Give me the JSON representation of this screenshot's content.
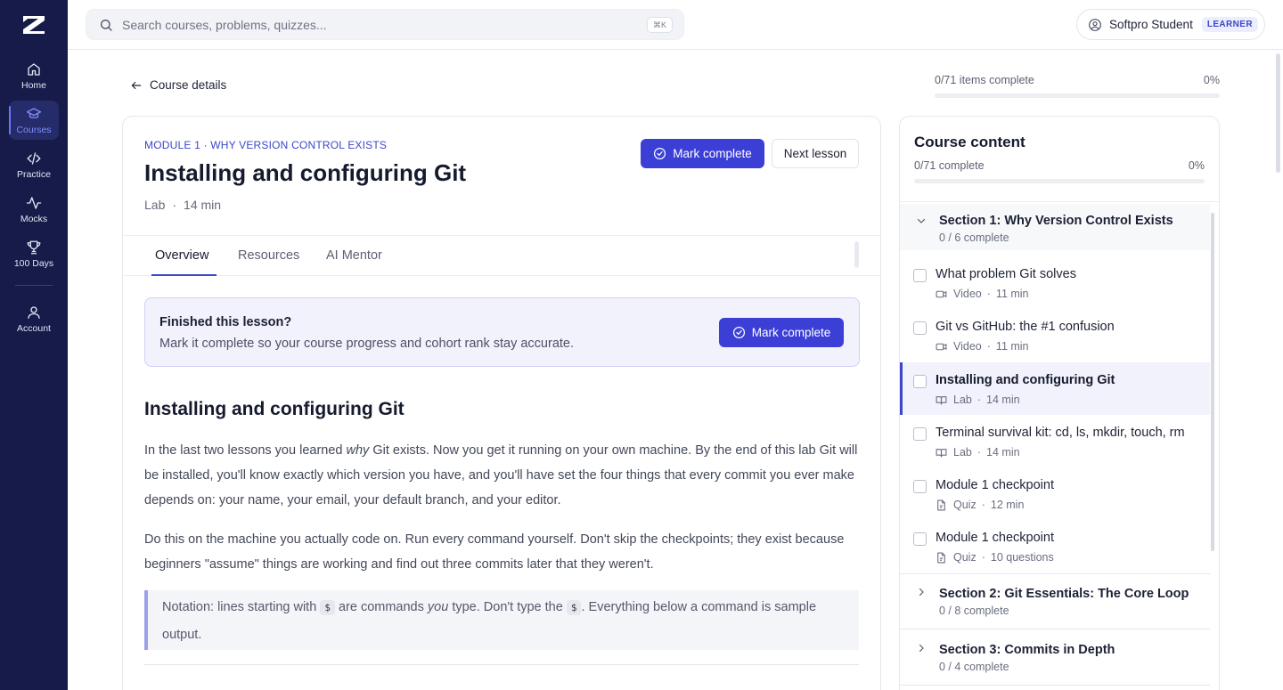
{
  "nav": {
    "items": [
      {
        "label": "Home",
        "icon": "home-icon"
      },
      {
        "label": "Courses",
        "icon": "courses-icon",
        "active": true
      },
      {
        "label": "Practice",
        "icon": "code-icon"
      },
      {
        "label": "Mocks",
        "icon": "activity-icon"
      },
      {
        "label": "100 Days",
        "icon": "trophy-icon"
      },
      {
        "label": "Account",
        "icon": "user-icon"
      }
    ]
  },
  "search": {
    "placeholder": "Search courses, problems, quizzes...",
    "shortcut": "⌘K"
  },
  "user": {
    "name": "Softpro Student",
    "role": "LEARNER"
  },
  "back_label": "Course details",
  "overall_progress": {
    "label": "0/71 items complete",
    "percent": "0%",
    "value": 0
  },
  "lesson": {
    "kicker": "MODULE 1 · WHY VERSION CONTROL EXISTS",
    "title": "Installing and configuring Git",
    "type": "Lab",
    "duration": "14 min",
    "mark_complete": "Mark complete",
    "next": "Next lesson"
  },
  "tabs": [
    {
      "label": "Overview",
      "active": true
    },
    {
      "label": "Resources"
    },
    {
      "label": "AI Mentor"
    }
  ],
  "notice": {
    "title": "Finished this lesson?",
    "text": "Mark it complete so your course progress and cohort rank stay accurate.",
    "button": "Mark complete"
  },
  "content": {
    "heading": "Installing and configuring Git",
    "p1_a": "In the last two lessons you learned ",
    "p1_em": "why",
    "p1_b": " Git exists. Now you get it running on your own machine. By the end of this lab Git will be installed, you'll know exactly which version you have, and you'll have set the four things that every commit you ever make depends on: your name, your email, your default branch, and your editor.",
    "p2": "Do this on the machine you actually code on. Run every command yourself. Don't skip the checkpoints; they exist because beginners \"assume\" things are working and find out three commits later that they weren't.",
    "note_a": "Notation: lines starting with ",
    "note_code1": "$",
    "note_b": " are commands ",
    "note_em": "you",
    "note_c": " type. Don't type the ",
    "note_code2": "$",
    "note_d": ". Everything below a command is sample output."
  },
  "course_content": {
    "title": "Course content",
    "progress_label": "0/71 complete",
    "percent": "0%",
    "progress_value": 0,
    "sections": [
      {
        "title": "Section 1: Why Version Control Exists",
        "sub": "0 / 6 complete",
        "open": true,
        "items": [
          {
            "title": "What problem Git solves",
            "kind": "Video",
            "meta": "11 min",
            "icon": "video-icon"
          },
          {
            "title": "Git vs GitHub: the #1 confusion",
            "kind": "Video",
            "meta": "11 min",
            "icon": "video-icon"
          },
          {
            "title": "Installing and configuring Git",
            "kind": "Lab",
            "meta": "14 min",
            "icon": "lab-icon",
            "current": true
          },
          {
            "title": "Terminal survival kit: cd, ls, mkdir, touch, rm",
            "kind": "Lab",
            "meta": "14 min",
            "icon": "lab-icon"
          },
          {
            "title": "Module 1 checkpoint",
            "kind": "Quiz",
            "meta": "12 min",
            "icon": "quiz-icon"
          },
          {
            "title": "Module 1 checkpoint",
            "kind": "Quiz",
            "meta": "10 questions",
            "icon": "quiz-icon"
          }
        ]
      },
      {
        "title": "Section 2: Git Essentials: The Core Loop",
        "sub": "0 / 8 complete"
      },
      {
        "title": "Section 3: Commits in Depth",
        "sub": "0 / 4 complete"
      }
    ]
  }
}
